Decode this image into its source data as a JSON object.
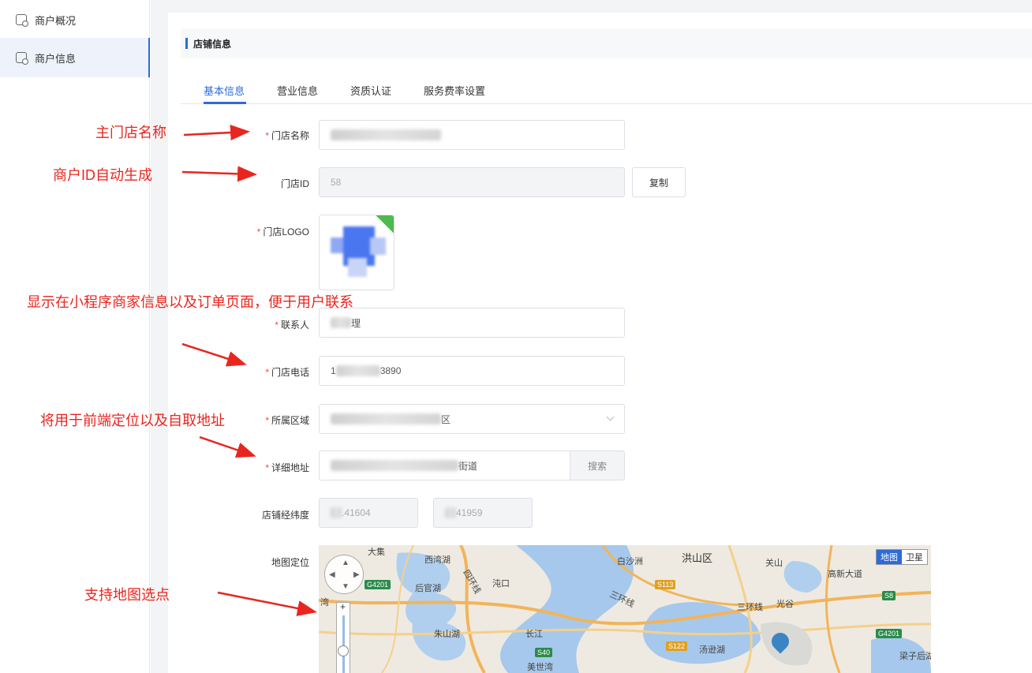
{
  "sidebar": {
    "items": [
      {
        "label": "商户概况",
        "icon": "store-icon"
      },
      {
        "label": "商户信息",
        "icon": "store-info-icon",
        "active": true
      }
    ]
  },
  "section": {
    "title": "店铺信息"
  },
  "tabs": [
    "基本信息",
    "营业信息",
    "资质认证",
    "服务费率设置"
  ],
  "form": {
    "store_name_label": "门店名称",
    "store_id_label": "门店ID",
    "store_id_value": "58",
    "copy_button": "复制",
    "logo_label": "门店LOGO",
    "contact_label": "联系人",
    "contact_value_visible": "理",
    "phone_label": "门店电话",
    "phone_value_prefix": "1",
    "phone_value_suffix": "3890",
    "region_label": "所属区域",
    "region_value_suffix": "区",
    "address_label": "详细地址",
    "address_value_suffix": "街道",
    "search_button": "搜索",
    "latlng_label": "店铺经纬度",
    "lng_value": ".41604",
    "lat_value": "41959",
    "map_label": "地图定位",
    "required_mark": "*"
  },
  "annotations": {
    "store_name": "主门店名称",
    "store_id": "商户ID自动生成",
    "contact": "显示在小程序商家信息以及订单页面，便于用户联系",
    "location": "将用于前端定位以及自取地址",
    "map": "支持地图选点"
  },
  "map": {
    "type_map": "地图",
    "type_satellite": "卫星",
    "labels": {
      "a": "大集",
      "b": "西湾湖",
      "c": "白沙洲",
      "d": "洪山区",
      "e": "关山",
      "f": "高新大道",
      "g": "后官湖",
      "h": "沌口",
      "i": "四环线",
      "j": "三环线",
      "k": "三环线",
      "l": "光谷",
      "m": "朱山湖",
      "n": "长江",
      "o": "汤逊湖",
      "p": "梁子后湖",
      "q": "美世湾",
      "r": "湾"
    },
    "shields": {
      "g4201": "G4201",
      "s113": "S113",
      "s8": "S8",
      "g4201b": "G4201",
      "s122": "S122",
      "s40": "S40"
    },
    "colors": {
      "accent": "#2d6bd8",
      "annotation": "#e8261f",
      "required": "#f24a4a"
    }
  }
}
